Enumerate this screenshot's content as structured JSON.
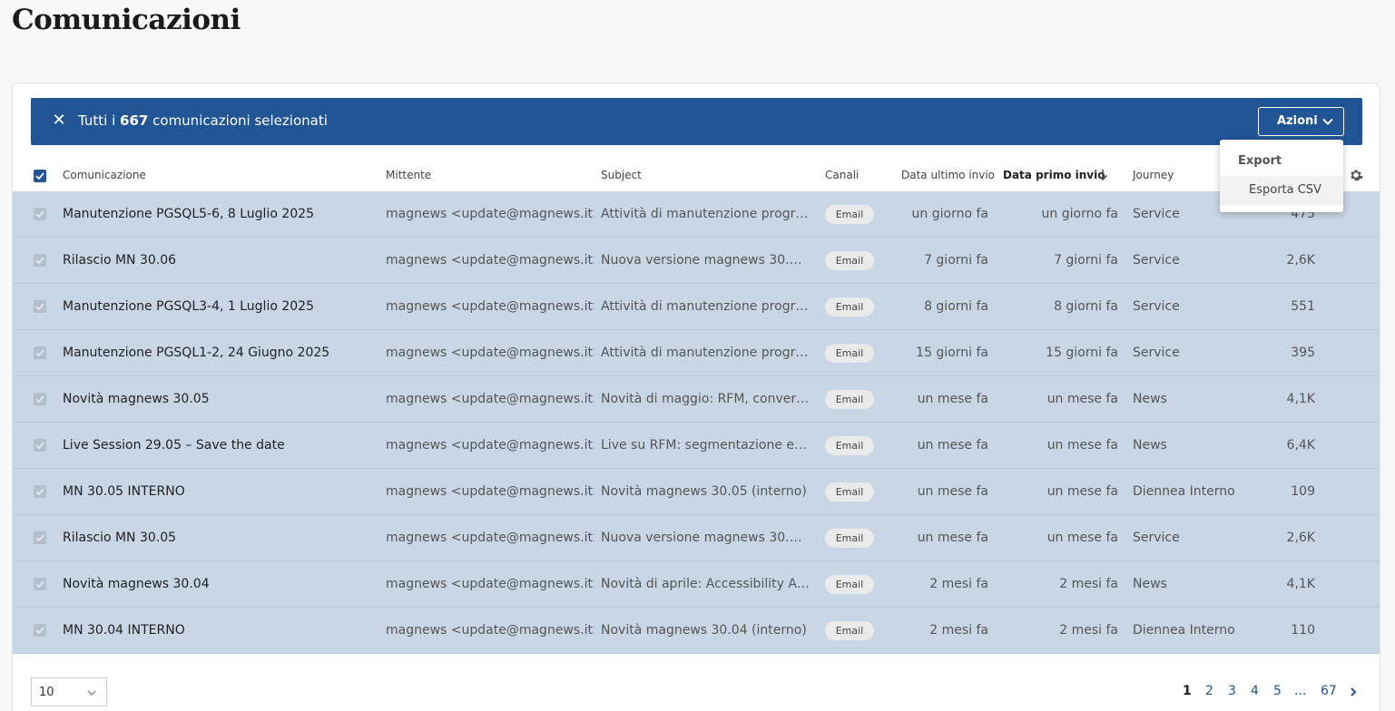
{
  "page": {
    "title": "Comunicazioni"
  },
  "selection": {
    "prefix": "Tutti i",
    "count": "667",
    "suffix": "comunicazioni selezionati",
    "actions_label": "Azioni"
  },
  "actions_menu": {
    "header": "Export",
    "items": [
      "Esporta CSV"
    ]
  },
  "table": {
    "columns": {
      "name": "Comunicazione",
      "sender": "Mittente",
      "subject": "Subject",
      "channels": "Canali",
      "last_send": "Data ultimo invio",
      "first_send": "Data primo invio",
      "journey": "Journey"
    },
    "sorted_column": "first_send",
    "rows": [
      {
        "name": "Manutenzione PGSQL5-6, 8 Luglio 2025",
        "sender": "magnews <update@magnews.it>",
        "subject": "Attività di manutenzione progra...",
        "channel": "Email",
        "last_send": "un giorno fa",
        "first_send": "un giorno fa",
        "journey": "Service",
        "count": "475"
      },
      {
        "name": "Rilascio MN 30.06",
        "sender": "magnews <update@magnews.it>",
        "subject": "Nuova versione magnews 30.06 ...",
        "channel": "Email",
        "last_send": "7 giorni fa",
        "first_send": "7 giorni fa",
        "journey": "Service",
        "count": "2,6K"
      },
      {
        "name": "Manutenzione PGSQL3-4, 1 Luglio 2025",
        "sender": "magnews <update@magnews.it>",
        "subject": "Attività di manutenzione progra...",
        "channel": "Email",
        "last_send": "8 giorni fa",
        "first_send": "8 giorni fa",
        "journey": "Service",
        "count": "551"
      },
      {
        "name": "Manutenzione PGSQL1-2, 24 Giugno 2025",
        "sender": "magnews <update@magnews.it>",
        "subject": "Attività di manutenzione progra...",
        "channel": "Email",
        "last_send": "15 giorni fa",
        "first_send": "15 giorni fa",
        "journey": "Service",
        "count": "395"
      },
      {
        "name": "Novità magnews 30.05",
        "sender": "magnews <update@magnews.it>",
        "subject": "Novità di maggio: RFM, conversi...",
        "channel": "Email",
        "last_send": "un mese fa",
        "first_send": "un mese fa",
        "journey": "News",
        "count": "4,1K"
      },
      {
        "name": "Live Session 29.05 – Save the date",
        "sender": "magnews <update@magnews.it>",
        "subject": "Live su RFM: segmentazione effi...",
        "channel": "Email",
        "last_send": "un mese fa",
        "first_send": "un mese fa",
        "journey": "News",
        "count": "6,4K"
      },
      {
        "name": "MN 30.05 INTERNO",
        "sender": "magnews <update@magnews.it>",
        "subject": "Novità magnews 30.05 (interno)",
        "channel": "Email",
        "last_send": "un mese fa",
        "first_send": "un mese fa",
        "journey": "Diennea Interno",
        "count": "109"
      },
      {
        "name": "Rilascio MN 30.05",
        "sender": "magnews <update@magnews.it>",
        "subject": "Nuova versione magnews 30.05 ...",
        "channel": "Email",
        "last_send": "un mese fa",
        "first_send": "un mese fa",
        "journey": "Service",
        "count": "2,6K"
      },
      {
        "name": "Novità magnews 30.04",
        "sender": "magnews <update@magnews.it>",
        "subject": "Novità di aprile: Accessibility Ass...",
        "channel": "Email",
        "last_send": "2 mesi fa",
        "first_send": "2 mesi fa",
        "journey": "News",
        "count": "4,1K"
      },
      {
        "name": "MN 30.04 INTERNO",
        "sender": "magnews <update@magnews.it>",
        "subject": "Novità magnews 30.04 (interno)",
        "channel": "Email",
        "last_send": "2 mesi fa",
        "first_send": "2 mesi fa",
        "journey": "Diennea Interno",
        "count": "110"
      }
    ]
  },
  "pagination": {
    "page_size": "10",
    "pages": [
      "1",
      "2",
      "3",
      "4",
      "5",
      "...",
      "67"
    ],
    "current": "1"
  },
  "colors": {
    "accent": "#225596",
    "selected_row": "#c9d6e6"
  },
  "icons": {
    "close": "close-icon",
    "chevron": "chevron-down-icon",
    "sort": "arrow-down-icon",
    "settings": "gear-icon",
    "next": "chevron-right-icon"
  }
}
